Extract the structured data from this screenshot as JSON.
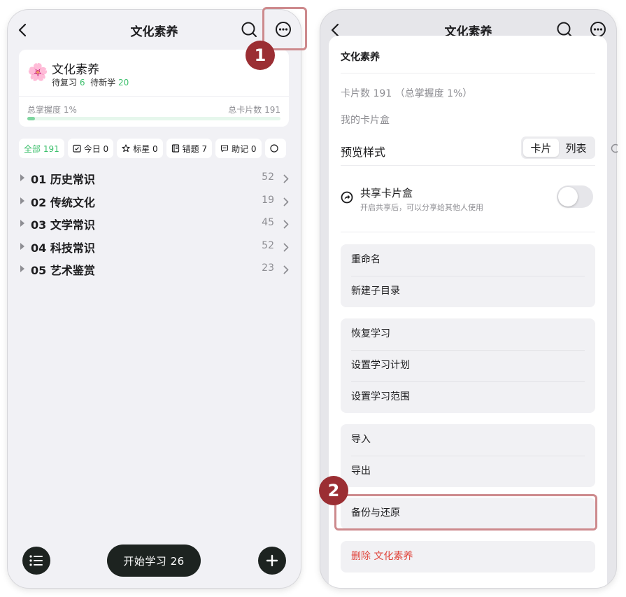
{
  "left": {
    "title": "文化素养",
    "deck": {
      "emoji": "🌸",
      "name": "文化素养",
      "review_label": "待复习",
      "review_count": "6",
      "new_label": "待新学",
      "new_count": "20",
      "mastery_label": "总掌握度 1%",
      "mastery_fraction": 0.01,
      "total_label": "总卡片数 191"
    },
    "filters": [
      {
        "label": "全部 191",
        "icon": "",
        "active": true
      },
      {
        "label": "今日 0",
        "icon": "calendar-check-icon",
        "active": false
      },
      {
        "label": "标星 0",
        "icon": "star-icon",
        "active": false
      },
      {
        "label": "错题 7",
        "icon": "notebook-icon",
        "active": false
      },
      {
        "label": "助记 0",
        "icon": "comment-icon",
        "active": false
      }
    ],
    "directories": [
      {
        "name": "01 历史常识",
        "count": "52"
      },
      {
        "name": "02 传统文化",
        "count": "19"
      },
      {
        "name": "03 文学常识",
        "count": "45"
      },
      {
        "name": "04 科技常识",
        "count": "52"
      },
      {
        "name": "05 艺术鉴赏",
        "count": "23"
      }
    ],
    "start_button": "开始学习 26"
  },
  "right": {
    "title": "文化素养",
    "sheet": {
      "title": "文化素养",
      "card_info": "卡片数 191 （总掌握度 1%）",
      "box_label": "我的卡片盒",
      "preview_label": "预览样式",
      "preview_options": [
        "卡片",
        "列表"
      ],
      "preview_selected": "卡片",
      "share_title": "共享卡片盒",
      "share_subtitle": "开启共享后，可以分享给其他人使用",
      "share_enabled": false,
      "group1": [
        "重命名",
        "新建子目录"
      ],
      "group2": [
        "恢复学习",
        "设置学习计划",
        "设置学习范围"
      ],
      "group3": [
        "导入",
        "导出"
      ],
      "backup": "备份与还原",
      "delete": "删除 文化素养"
    }
  },
  "annotations": {
    "step1": "1",
    "step2": "2",
    "highlight_color": "#cd8a8d",
    "badge_color": "#9b2e33"
  },
  "colors": {
    "accent_green": "#3bbf6b",
    "danger_red": "#e0453c",
    "dark_button": "#1d2320"
  }
}
